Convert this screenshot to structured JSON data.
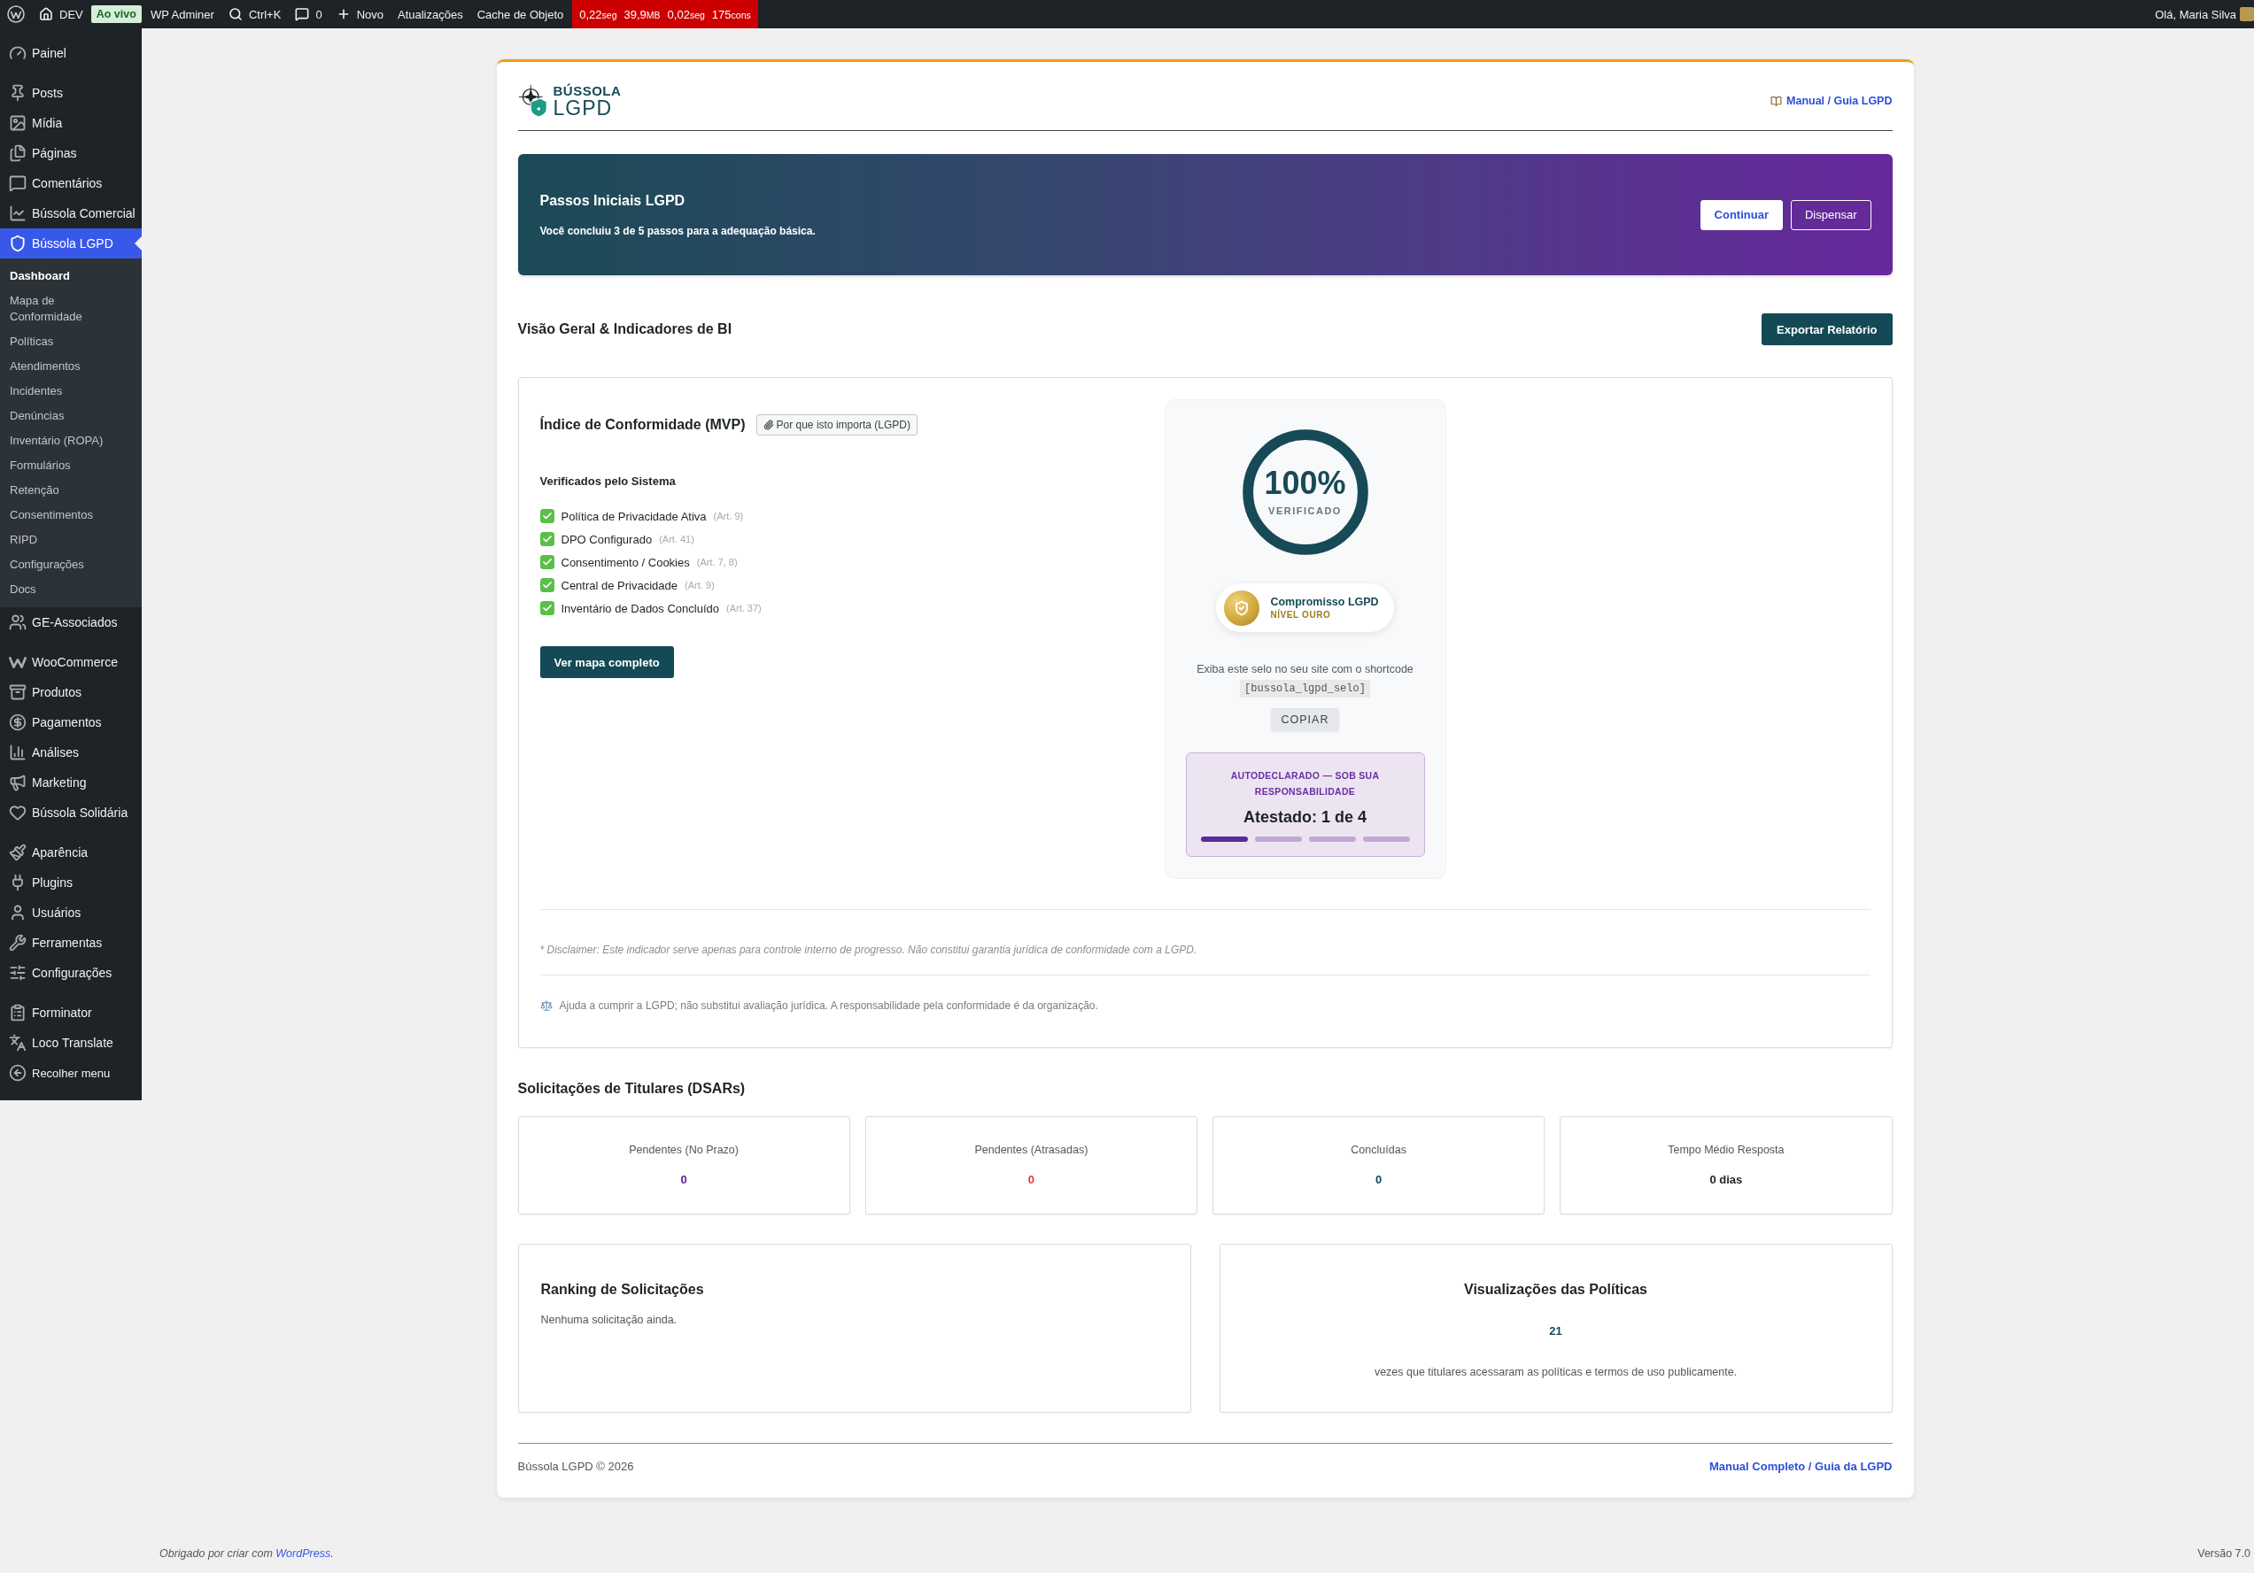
{
  "admin_bar": {
    "items": [
      {
        "kind": "site",
        "label": "DEV"
      },
      {
        "kind": "badge",
        "label": "Ao vivo"
      },
      {
        "kind": "plain",
        "label": "WP Adminer"
      },
      {
        "kind": "search",
        "label": "Ctrl+K"
      },
      {
        "kind": "comments",
        "label": "0"
      },
      {
        "kind": "new",
        "label": "Novo"
      },
      {
        "kind": "plain",
        "label": "Atualizações"
      },
      {
        "kind": "plain",
        "label": "Cache de Objeto"
      }
    ],
    "metrics": [
      {
        "value": "0,22",
        "unit": "seg"
      },
      {
        "value": "39,9",
        "unit": "MB"
      },
      {
        "value": "0,02",
        "unit": "seg"
      },
      {
        "value": "175",
        "unit": "cons"
      }
    ],
    "greeting": "Olá, Maria Silva"
  },
  "sidebar": {
    "groups": [
      {
        "items": [
          {
            "label": "Painel",
            "selected": false
          }
        ]
      },
      {
        "items": [
          {
            "label": "Posts",
            "selected": false
          },
          {
            "label": "Mídia",
            "selected": false
          },
          {
            "label": "Páginas",
            "selected": false
          },
          {
            "label": "Comentários",
            "selected": false
          },
          {
            "label": "Bússola Comercial",
            "selected": false
          },
          {
            "label": "Bússola LGPD",
            "selected": true,
            "children": [
              {
                "label": "Dashboard",
                "selected": true
              },
              {
                "label": "Mapa de Conformidade",
                "selected": false
              },
              {
                "label": "Políticas",
                "selected": false
              },
              {
                "label": "Atendimentos",
                "selected": false
              },
              {
                "label": "Incidentes",
                "selected": false
              },
              {
                "label": "Denúncias",
                "selected": false
              },
              {
                "label": "Inventário (ROPA)",
                "selected": false
              },
              {
                "label": "Formulários",
                "selected": false
              },
              {
                "label": "Retenção",
                "selected": false
              },
              {
                "label": "Consentimentos",
                "selected": false
              },
              {
                "label": "RIPD",
                "selected": false
              },
              {
                "label": "Configurações",
                "selected": false
              },
              {
                "label": "Docs",
                "selected": false
              }
            ]
          },
          {
            "label": "GE-Associados",
            "selected": false
          }
        ]
      },
      {
        "items": [
          {
            "label": "WooCommerce",
            "selected": false
          },
          {
            "label": "Produtos",
            "selected": false
          },
          {
            "label": "Pagamentos",
            "selected": false
          },
          {
            "label": "Análises",
            "selected": false
          },
          {
            "label": "Marketing",
            "selected": false
          },
          {
            "label": "Bússola Solidária",
            "selected": false
          }
        ]
      },
      {
        "items": [
          {
            "label": "Aparência",
            "selected": false
          },
          {
            "label": "Plugins",
            "selected": false
          },
          {
            "label": "Usuários",
            "selected": false
          },
          {
            "label": "Ferramentas",
            "selected": false
          },
          {
            "label": "Configurações",
            "selected": false
          }
        ]
      },
      {
        "items": [
          {
            "label": "Forminator",
            "selected": false
          },
          {
            "label": "Loco Translate",
            "selected": false
          }
        ]
      }
    ],
    "collapse": "Recolher menu"
  },
  "header": {
    "logo_top": "BÚSSOLA",
    "logo_bottom": "LGPD",
    "guide_link": "Manual / Guia LGPD"
  },
  "onboarding": {
    "title": "Passos Iniciais LGPD",
    "text": "Você concluiu 3 de 5 passos para a adequação básica.",
    "buttons": [
      {
        "kind": "primary",
        "label": "Continuar"
      },
      {
        "kind": "outline",
        "label": "Dispensar"
      }
    ]
  },
  "overview": {
    "title": "Visão Geral & Indicadores de BI",
    "export_button": "Exportar Relatório"
  },
  "compliance": {
    "title": "Índice de Conformidade (MVP)",
    "why_button": "Por que isto importa (LGPD)",
    "checks_title": "Verificados pelo Sistema",
    "checks": [
      {
        "label": "Política de Privacidade Ativa",
        "ref": "(Art. 9)",
        "checked": true
      },
      {
        "label": "DPO Configurado",
        "ref": "(Art. 41)",
        "checked": true
      },
      {
        "label": "Consentimento / Cookies",
        "ref": "(Art. 7, 8)",
        "checked": true
      },
      {
        "label": "Central de Privacidade",
        "ref": "(Art. 9)",
        "checked": true
      },
      {
        "label": "Inventário de Dados Concluído",
        "ref": "(Art. 37)",
        "checked": true
      }
    ],
    "map_button": "Ver mapa completo",
    "score": {
      "value": "100%",
      "caption": "VERIFICADO",
      "level": 1
    },
    "seal": {
      "title": "Compromisso LGPD",
      "tier": "NÍVEL OURO"
    },
    "shortcode_hint": "Exiba este selo no seu site com o shortcode",
    "shortcode": "[bussola_lgpd_selo]",
    "copy_button": "COPIAR",
    "attestation": {
      "label": "AUTODECLARADO — SOB SUA RESPONSABILIDADE",
      "title": "Atestado: 1 de 4",
      "steps": [
        {
          "done": true
        },
        {
          "done": false
        },
        {
          "done": false
        },
        {
          "done": false
        }
      ]
    },
    "disclaimer": "* Disclaimer: Este indicador serve apenas para controle interno de progresso. Não constitui garantia jurídica de conformidade com a LGPD.",
    "note": "Ajuda a cumprir a LGPD; não substitui avaliação jurídica. A responsabilidade pela conformidade é da organização."
  },
  "dsar": {
    "title": "Solicitações de Titulares (DSARs)",
    "stats": [
      {
        "label": "Pendentes (No Prazo)",
        "value": "0",
        "color": "#6a1b9a"
      },
      {
        "label": "Pendentes (Atrasadas)",
        "value": "0",
        "color": "#e53935"
      },
      {
        "label": "Concluídas",
        "value": "0",
        "color": "#134a55"
      },
      {
        "label": "Tempo Médio Resposta",
        "value": "0 dias",
        "color": "#1d2327"
      }
    ]
  },
  "ranking": {
    "title": "Ranking de Solicitações",
    "empty_text": "Nenhuma solicitação ainda."
  },
  "policy_views": {
    "title": "Visualizações das Políticas",
    "value": "21",
    "caption": "vezes que titulares acessaram as políticas e termos de uso publicamente."
  },
  "footer": {
    "brand": "Bússola LGPD © 2026",
    "link": "Manual Completo / Guia da LGPD"
  },
  "wp_footer": {
    "text": "Obrigado por criar com",
    "link": "WordPress",
    "after": ".",
    "version": "Versão 7.0"
  }
}
